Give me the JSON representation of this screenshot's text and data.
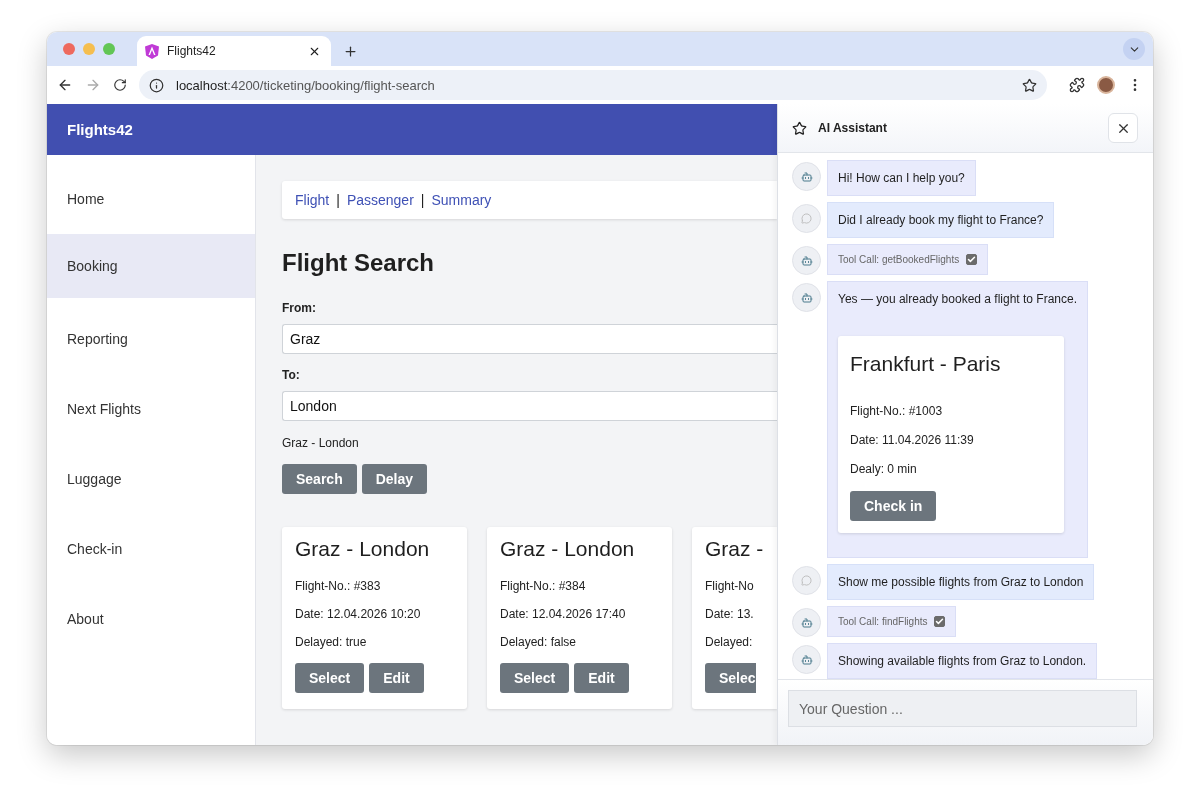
{
  "browser": {
    "tab_title": "Flights42",
    "url_host": "localhost",
    "url_path": ":4200/ticketing/booking/flight-search",
    "forward_disabled": true
  },
  "app": {
    "brand": "Flights42"
  },
  "sidebar": {
    "items": [
      {
        "label": "Home",
        "selected": false
      },
      {
        "label": "Booking",
        "selected": true
      },
      {
        "label": "Reporting",
        "selected": false
      },
      {
        "label": "Next Flights",
        "selected": false
      },
      {
        "label": "Luggage",
        "selected": false
      },
      {
        "label": "Check-in",
        "selected": false
      },
      {
        "label": "About",
        "selected": false
      }
    ]
  },
  "breadcrumb": [
    {
      "kind": "link",
      "label": "Flight"
    },
    {
      "kind": "separator",
      "label": "|"
    },
    {
      "kind": "link",
      "label": "Passenger"
    },
    {
      "kind": "separator",
      "label": "|"
    },
    {
      "kind": "link",
      "label": "Summary"
    }
  ],
  "search": {
    "title": "Flight Search",
    "from_label": "From:",
    "from_value": "Graz",
    "to_label": "To:",
    "to_value": "London",
    "summary": "Graz - London",
    "buttons": [
      "Search",
      "Delay"
    ]
  },
  "flights": [
    {
      "title": "Graz - London",
      "number": "Flight-No.: #383",
      "date": "Date: 12.04.2026 10:20",
      "delayed": "Delayed: true",
      "buttons": [
        "Select",
        "Edit"
      ]
    },
    {
      "title": "Graz - London",
      "number": "Flight-No.: #384",
      "date": "Date: 12.04.2026 17:40",
      "delayed": "Delayed: false",
      "buttons": [
        "Select",
        "Edit"
      ]
    },
    {
      "title": "Graz -",
      "number": "Flight-No",
      "date": "Date: 13.",
      "delayed": "Delayed:",
      "buttons": [
        "Selec"
      ]
    }
  ],
  "assistant": {
    "title": "AI Assistant",
    "placeholder": "Your Question ...",
    "messages": [
      {
        "kind": "text",
        "from_user": false,
        "text": "Hi! How can I help you?"
      },
      {
        "kind": "text",
        "from_user": true,
        "text": "Did I already book my flight to France?"
      },
      {
        "kind": "tool",
        "from_user": false,
        "text": "Tool Call: getBookedFlights",
        "checked": true
      },
      {
        "kind": "card",
        "from_user": false,
        "text": "Yes — you already booked a flight to France.",
        "card": {
          "title": "Frankfurt - Paris",
          "number": "Flight-No.: #1003",
          "date": "Date: 11.04.2026 11:39",
          "delay": "Dealy: 0 min",
          "button": "Check in"
        }
      },
      {
        "kind": "text",
        "from_user": true,
        "text": "Show me possible flights from Graz to London"
      },
      {
        "kind": "tool",
        "from_user": false,
        "text": "Tool Call: findFlights",
        "checked": true
      },
      {
        "kind": "text",
        "from_user": false,
        "text": "Showing available flights from Graz to London."
      }
    ]
  }
}
